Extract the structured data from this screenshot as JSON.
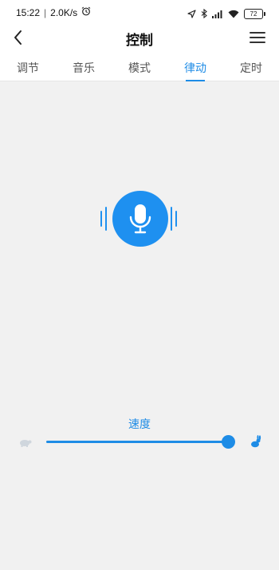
{
  "status_bar": {
    "time": "15:22",
    "network_speed": "2.0K/s",
    "battery": "72",
    "icons": [
      "alarm-icon",
      "location-icon",
      "bluetooth-icon",
      "signal-icon",
      "wifi-icon",
      "battery-icon"
    ]
  },
  "header": {
    "title": "控制",
    "back_icon": "back-chevron-icon",
    "menu_icon": "hamburger-menu-icon"
  },
  "tabs": [
    {
      "label": "调节",
      "active": false
    },
    {
      "label": "音乐",
      "active": false
    },
    {
      "label": "模式",
      "active": false
    },
    {
      "label": "律动",
      "active": true
    },
    {
      "label": "定时",
      "active": false
    }
  ],
  "mic": {
    "icon": "microphone-icon",
    "color": "#1e90f0"
  },
  "speed": {
    "label": "速度",
    "value": 1.0,
    "slow_icon": "turtle-icon",
    "fast_icon": "rabbit-icon"
  },
  "colors": {
    "accent": "#1e8ce6",
    "background": "#f1f1f1"
  }
}
